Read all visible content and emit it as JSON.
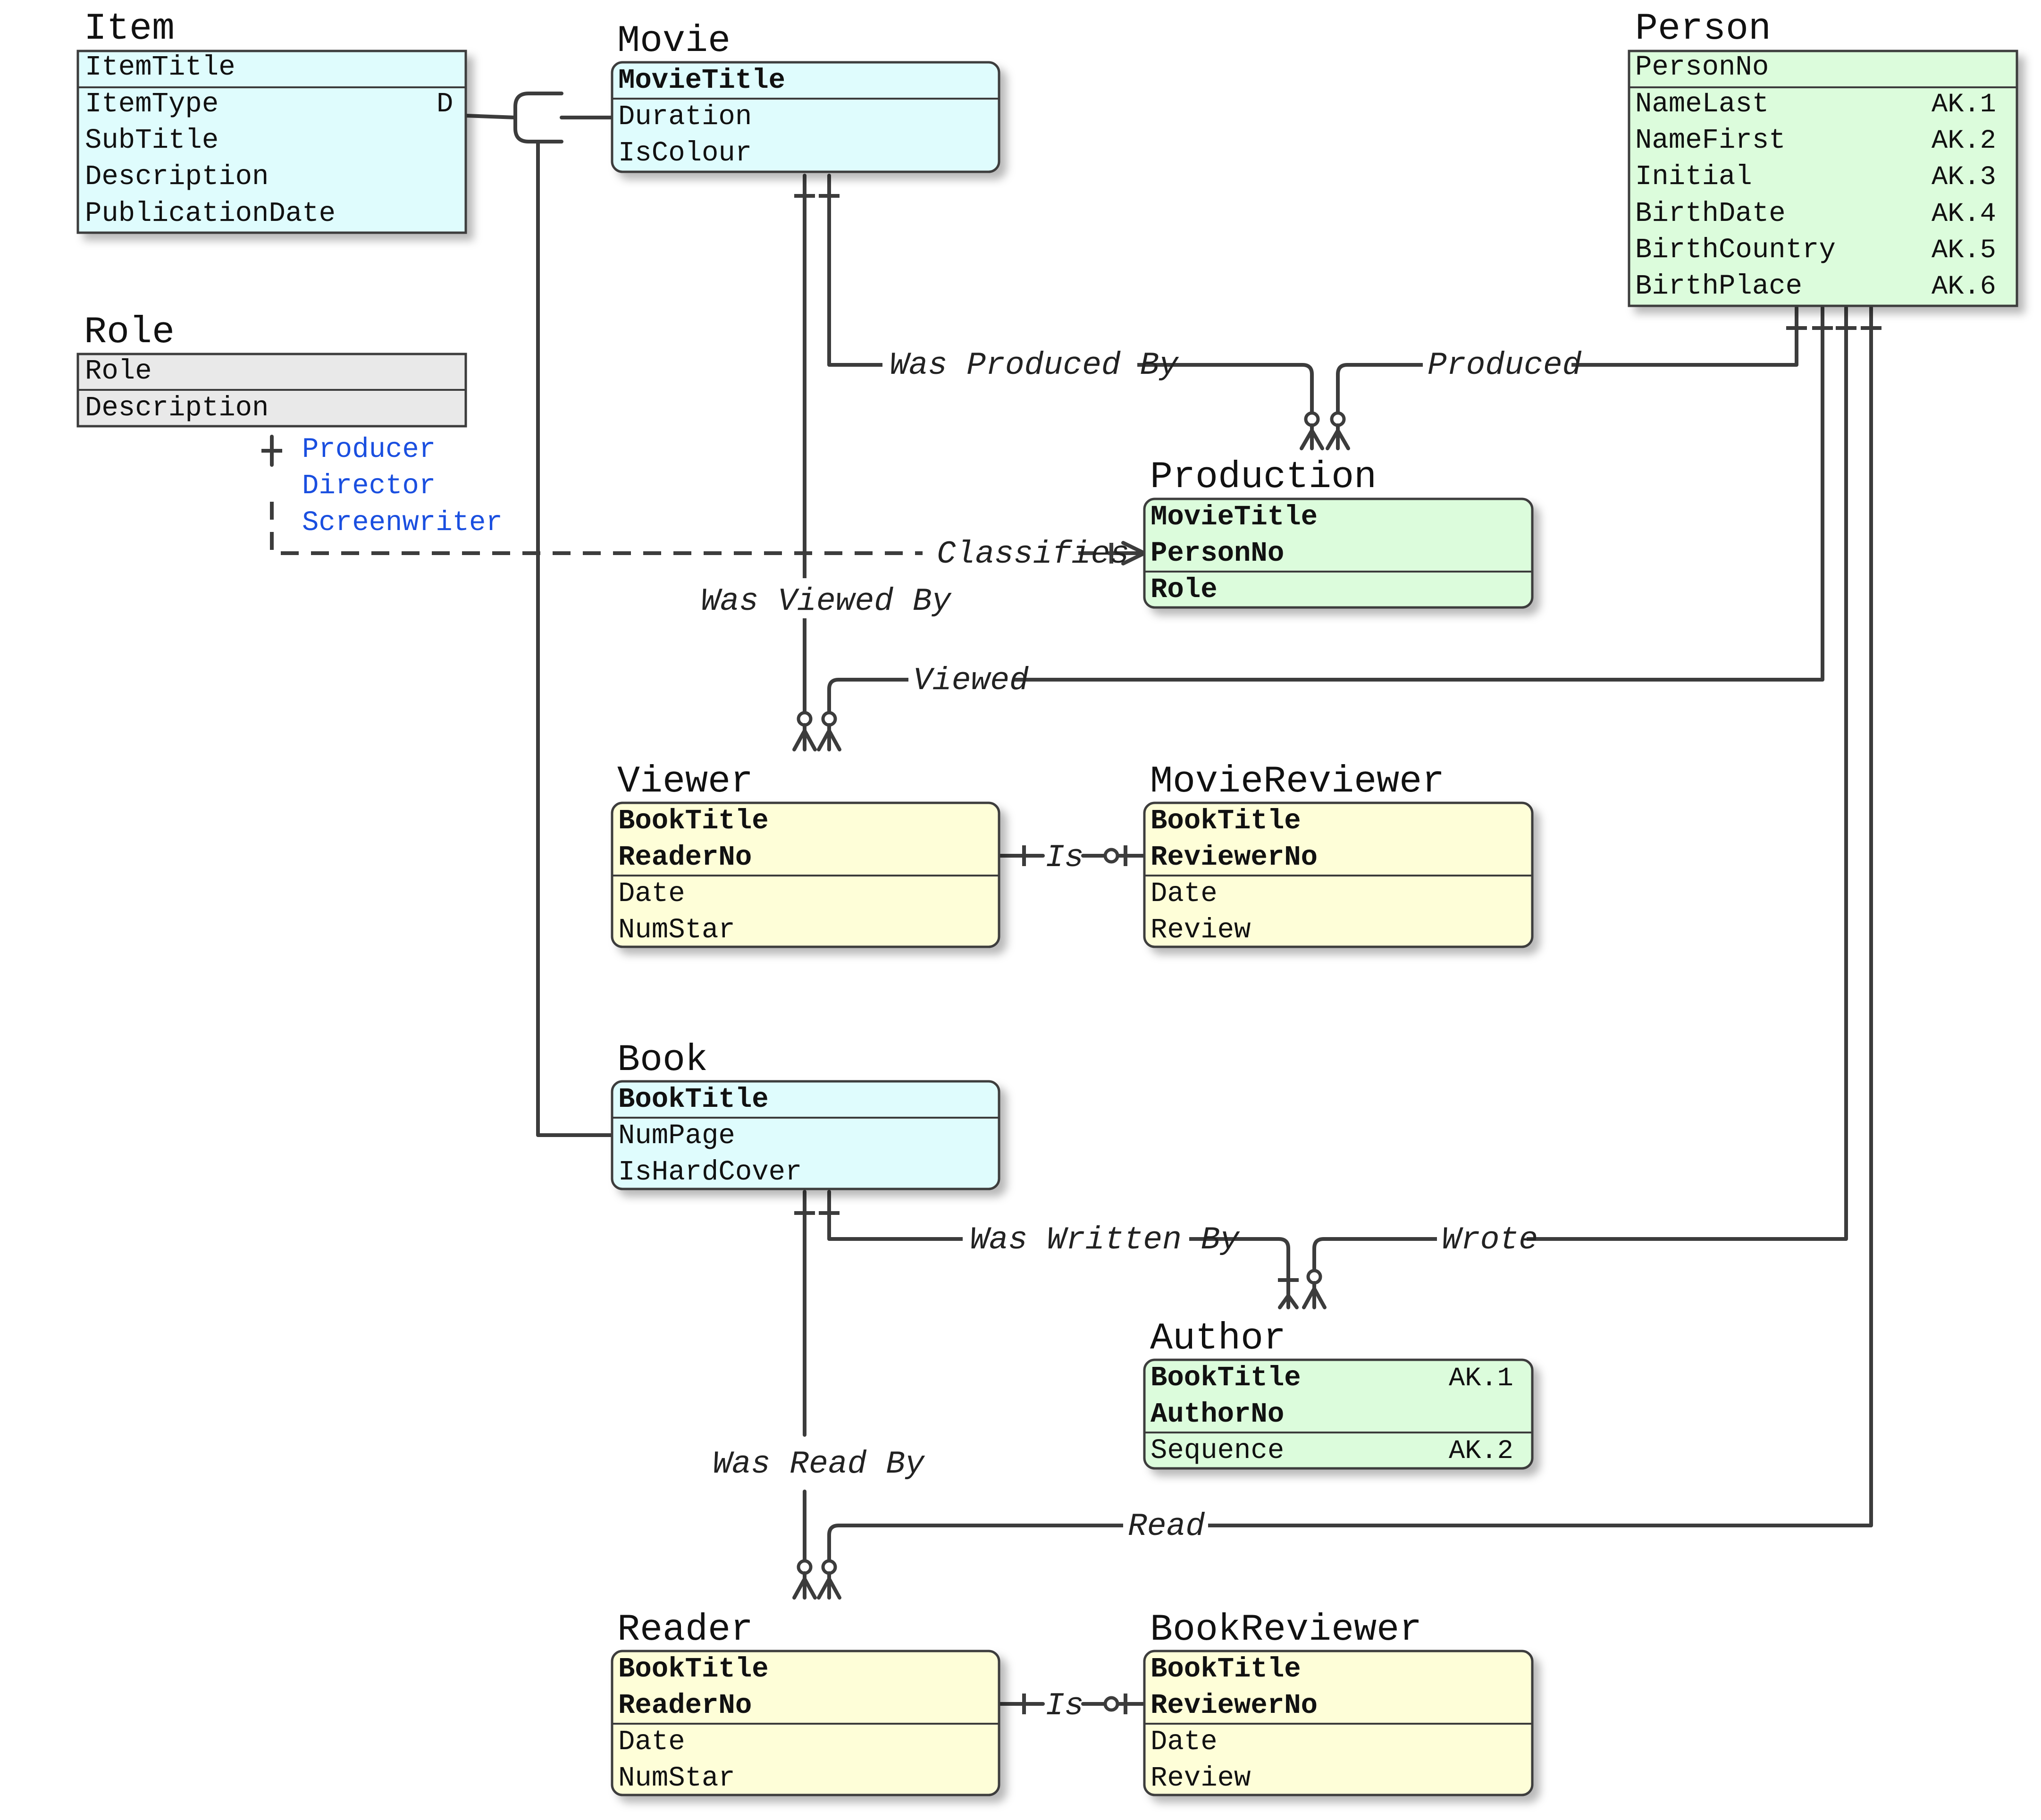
{
  "colors": {
    "independent_fill": "#dffcfd",
    "associative_fill": "#dcfcdc",
    "subtype_fill": "#fefed8",
    "reference_fill": "#e9e9e9",
    "line": "#3c3c3c",
    "role_values": "#1a4fe0"
  },
  "entities": {
    "item": {
      "title": "Item",
      "attrs": [
        "ItemTitle",
        "ItemType",
        "SubTitle",
        "Description",
        "PublicationDate"
      ],
      "discriminator": "D"
    },
    "role": {
      "title": "Role",
      "attrs": [
        "Role",
        "Description"
      ],
      "values": [
        "Producer",
        "Director",
        "Screenwriter"
      ]
    },
    "movie": {
      "title": "Movie",
      "attrs": [
        "MovieTitle",
        "Duration",
        "IsColour"
      ]
    },
    "person": {
      "title": "Person",
      "attrs": [
        "PersonNo",
        "NameLast",
        "NameFirst",
        "Initial",
        "BirthDate",
        "BirthCountry",
        "BirthPlace"
      ],
      "aks": [
        "AK.1",
        "AK.2",
        "AK.3",
        "AK.4",
        "AK.5",
        "AK.6"
      ]
    },
    "production": {
      "title": "Production",
      "attrs": [
        "MovieTitle",
        "PersonNo",
        "Role"
      ]
    },
    "viewer": {
      "title": "Viewer",
      "attrs": [
        "BookTitle",
        "ReaderNo",
        "Date",
        "NumStar"
      ]
    },
    "moviereviewer": {
      "title": "MovieReviewer",
      "attrs": [
        "BookTitle",
        "ReviewerNo",
        "Date",
        "Review"
      ]
    },
    "book": {
      "title": "Book",
      "attrs": [
        "BookTitle",
        "NumPage",
        "IsHardCover"
      ]
    },
    "author": {
      "title": "Author",
      "attrs": [
        "BookTitle",
        "AuthorNo",
        "Sequence"
      ],
      "aks": [
        "AK.1",
        "AK.2"
      ]
    },
    "reader": {
      "title": "Reader",
      "attrs": [
        "BookTitle",
        "ReaderNo",
        "Date",
        "NumStar"
      ]
    },
    "bookreviewer": {
      "title": "BookReviewer",
      "attrs": [
        "BookTitle",
        "ReviewerNo",
        "Date",
        "Review"
      ]
    }
  },
  "relationships": {
    "was_produced_by": "Was Produced By",
    "produced": "Produced",
    "classifies": "Classifies",
    "was_viewed_by": "Was Viewed By",
    "viewed": "Viewed",
    "viewer_is": "Is",
    "was_written_by": "Was Written By",
    "wrote": "Wrote",
    "was_read_by": "Was Read By",
    "read": "Read",
    "reader_is": "Is"
  }
}
